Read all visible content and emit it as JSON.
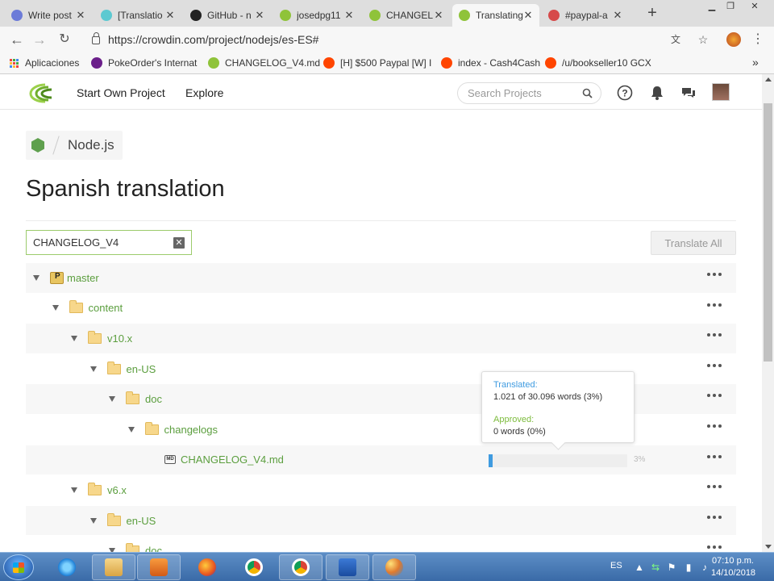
{
  "browser": {
    "tabs": [
      {
        "title": "Write post",
        "color": "#6c7bd8"
      },
      {
        "title": "[Translatio",
        "color": "#5cc9d1"
      },
      {
        "title": "GitHub - n",
        "color": "#222222"
      },
      {
        "title": "josedpg11",
        "color": "#8fc33a"
      },
      {
        "title": "CHANGEL",
        "color": "#8fc33a"
      },
      {
        "title": "Translating",
        "color": "#8fc33a"
      },
      {
        "title": "#paypal-a",
        "color": "#d64a4a"
      }
    ],
    "url": "https://crowdin.com/project/nodejs/es-ES#",
    "bookmarks": [
      {
        "label": "Aplicaciones",
        "color": "#e44"
      },
      {
        "label": "PokeOrder's Internat",
        "color": "#6b1f8a"
      },
      {
        "label": "CHANGELOG_V4.md",
        "color": "#8fc33a"
      },
      {
        "label": "[H] $500 Paypal [W] I",
        "color": "#ff4500"
      },
      {
        "label": "index - Cash4Cash",
        "color": "#ff4500"
      },
      {
        "label": "/u/bookseller10 GCX",
        "color": "#ff4500"
      }
    ]
  },
  "topnav": {
    "start_project": "Start Own Project",
    "explore": "Explore",
    "search_placeholder": "Search Projects"
  },
  "breadcrumb": {
    "project": "Node.js"
  },
  "page_title": "Spanish translation",
  "filter": {
    "value": "CHANGELOG_V4",
    "clear": "✕"
  },
  "translate_all": "Translate All",
  "tree": [
    {
      "label": "master",
      "type": "branch",
      "indent": 0,
      "toggle": true,
      "alt": true
    },
    {
      "label": "content",
      "type": "folder",
      "indent": 1,
      "toggle": true,
      "alt": false
    },
    {
      "label": "v10.x",
      "type": "folder",
      "indent": 2,
      "toggle": true,
      "alt": true
    },
    {
      "label": "en-US",
      "type": "folder",
      "indent": 3,
      "toggle": true,
      "alt": false
    },
    {
      "label": "doc",
      "type": "folder",
      "indent": 4,
      "toggle": true,
      "alt": true
    },
    {
      "label": "changelogs",
      "type": "folder",
      "indent": 5,
      "toggle": true,
      "alt": false
    },
    {
      "label": "CHANGELOG_V4.md",
      "type": "file",
      "indent": 6,
      "toggle": false,
      "alt": true,
      "progress": 3,
      "progress_label": "3%"
    },
    {
      "label": "v6.x",
      "type": "folder",
      "indent": 2,
      "toggle": true,
      "alt": false
    },
    {
      "label": "en-US",
      "type": "folder",
      "indent": 3,
      "toggle": true,
      "alt": true
    },
    {
      "label": "doc",
      "type": "folder",
      "indent": 4,
      "toggle": true,
      "alt": false
    }
  ],
  "popover": {
    "translated_label": "Translated:",
    "translated_value": "1.021 of 30.096 words (3%)",
    "approved_label": "Approved:",
    "approved_value": "0 words (0%)",
    "translated_color": "#3f9be0",
    "approved_color": "#7cbb3c"
  },
  "taskbar": {
    "language": "ES",
    "time": "07:10 p.m.",
    "date": "14/10/2018"
  },
  "colors": {
    "accent_green": "#5b9e3e",
    "progress_blue": "#3f9be0"
  }
}
